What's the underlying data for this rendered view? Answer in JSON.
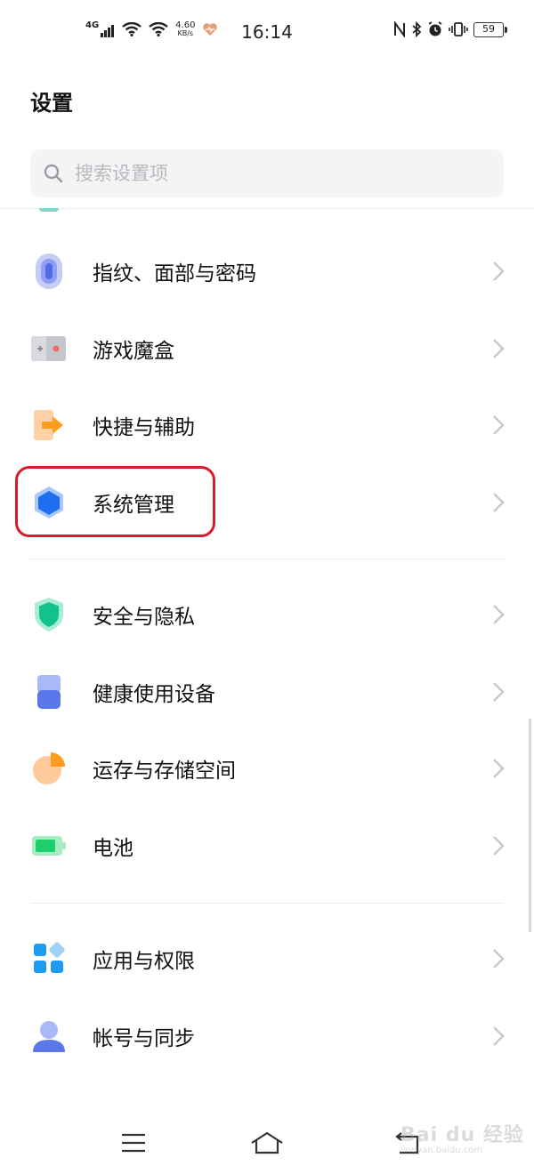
{
  "status_bar": {
    "network_type": "4G",
    "speed_value": "4.60",
    "speed_unit": "KB/s",
    "time": "16:14",
    "battery": "59"
  },
  "header": {
    "title": "设置"
  },
  "search": {
    "placeholder": "搜索设置项"
  },
  "groups": [
    {
      "items": [
        {
          "label": "指纹、面部与密码",
          "icon": "fingerprint-icon"
        },
        {
          "label": "游戏魔盒",
          "icon": "game-box-icon"
        },
        {
          "label": "快捷与辅助",
          "icon": "shortcut-icon"
        },
        {
          "label": "系统管理",
          "icon": "system-management-icon",
          "highlighted": true
        }
      ]
    },
    {
      "items": [
        {
          "label": "安全与隐私",
          "icon": "shield-icon"
        },
        {
          "label": "健康使用设备",
          "icon": "health-device-icon"
        },
        {
          "label": "运存与存储空间",
          "icon": "storage-pie-icon"
        },
        {
          "label": "电池",
          "icon": "battery-icon"
        }
      ]
    },
    {
      "items": [
        {
          "label": "应用与权限",
          "icon": "apps-permissions-icon"
        },
        {
          "label": "帐号与同步",
          "icon": "account-icon"
        }
      ]
    }
  ],
  "watermark": {
    "brand": "Bai du 经验",
    "url": "jingyan.baidu.com"
  }
}
